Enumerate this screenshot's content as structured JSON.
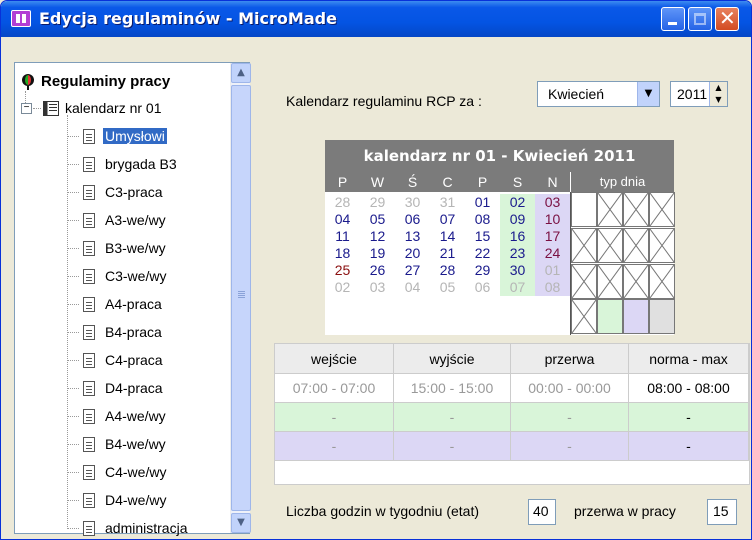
{
  "window": {
    "title": "Edycja regulaminów - MicroMade"
  },
  "tree": {
    "root": "Regulaminy pracy",
    "node": "kalendarz nr 01",
    "items": [
      "Umysłowi",
      "brygada B3",
      "C3-praca",
      "A3-we/wy",
      "B3-we/wy",
      "C3-we/wy",
      "A4-praca",
      "B4-praca",
      "C4-praca",
      "D4-praca",
      "A4-we/wy",
      "B4-we/wy",
      "C4-we/wy",
      "D4-we/wy",
      "administracja"
    ],
    "selected_index": 0
  },
  "header": {
    "label": "Kalendarz regulaminu RCP  za :",
    "month": "Kwiecień",
    "year": "2011"
  },
  "calendar": {
    "title": "kalendarz nr 01 - Kwiecień 2011",
    "weekdays": [
      "P",
      "W",
      "Ś",
      "C",
      "P",
      "S",
      "N"
    ],
    "type_label": "typ dnia",
    "weeks": [
      [
        "28",
        "29",
        "30",
        "31",
        "01",
        "02",
        "03"
      ],
      [
        "04",
        "05",
        "06",
        "07",
        "08",
        "09",
        "10"
      ],
      [
        "11",
        "12",
        "13",
        "14",
        "15",
        "16",
        "17"
      ],
      [
        "18",
        "19",
        "20",
        "21",
        "22",
        "23",
        "24"
      ],
      [
        "25",
        "26",
        "27",
        "28",
        "29",
        "30",
        "01"
      ],
      [
        "02",
        "03",
        "04",
        "05",
        "06",
        "07",
        "08"
      ]
    ],
    "colors": {
      "weekday": "#1a1a8c",
      "muted": "#b5b5b5",
      "sunday": "#7a1042",
      "holiday": "#8b1010",
      "sat_bg": "#d9f5d9",
      "sun_bg": "#dcd7f5"
    }
  },
  "schedule": {
    "columns": [
      "wejście",
      "wyjście",
      "przerwa",
      "norma - max"
    ],
    "rows": [
      [
        "07:00 - 07:00",
        "15:00 - 15:00",
        "00:00 - 00:00",
        "08:00 - 08:00"
      ],
      [
        "-",
        "-",
        "-",
        "-"
      ],
      [
        "-",
        "-",
        "-",
        "-"
      ]
    ]
  },
  "footer": {
    "hours_label": "Liczba godzin w tygodniu (etat)",
    "hours_value": "40",
    "break_label": "przerwa w pracy",
    "break_value": "15"
  }
}
